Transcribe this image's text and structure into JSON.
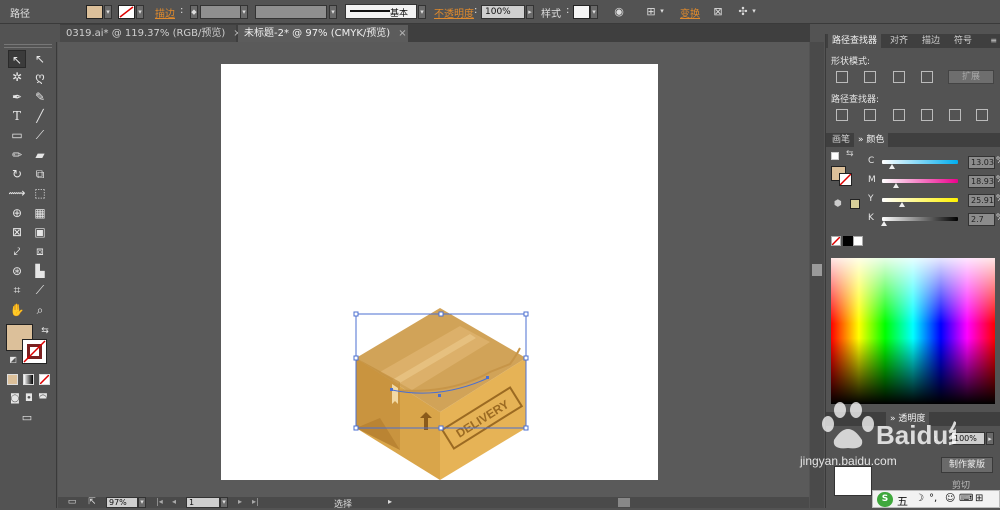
{
  "control_bar": {
    "selection_label": "路径",
    "stroke_label": "描边",
    "stroke_profile": "基本",
    "opacity_label": "不透明度",
    "opacity_value": "100%",
    "style_label": "样式",
    "transform_label": "变换",
    "fill_color": "#dcc09a"
  },
  "tabs": [
    {
      "label": "0319.ai* @ 119.37% (RGB/预览)",
      "close": "×"
    },
    {
      "label": "未标题-2* @ 97% (CMYK/预览)",
      "close": "×"
    }
  ],
  "status": {
    "zoom": "97%",
    "page": "1",
    "tool_name": "选择"
  },
  "pathfinder": {
    "tabs": [
      "路径查找器",
      "对齐",
      "描边",
      "符号"
    ],
    "shape_modes_label": "形状模式",
    "expand_label": "扩展",
    "pathfinders_label": "路径查找器"
  },
  "color_panel": {
    "tabs": [
      "画笔",
      "颜色"
    ],
    "channels": [
      {
        "label": "C",
        "value": "13.03",
        "pct": 0.13,
        "unit": "%"
      },
      {
        "label": "M",
        "value": "18.93",
        "pct": 0.19,
        "unit": "%"
      },
      {
        "label": "Y",
        "value": "25.91",
        "pct": 0.26,
        "unit": "%"
      },
      {
        "label": "K",
        "value": "2.7",
        "pct": 0.03,
        "unit": "%"
      }
    ],
    "fill_color": "#dcc09a"
  },
  "transparency_panel": {
    "tab": "透明度",
    "opacity_value": "100%",
    "make_mask_label": "制作蒙版",
    "clip_label": "剪切"
  },
  "artwork": {
    "box_label": "DELIVERY"
  },
  "watermark": {
    "brand": "Baidu经验",
    "url": "jingyan.baidu.com"
  },
  "ime": {
    "label": "五"
  }
}
